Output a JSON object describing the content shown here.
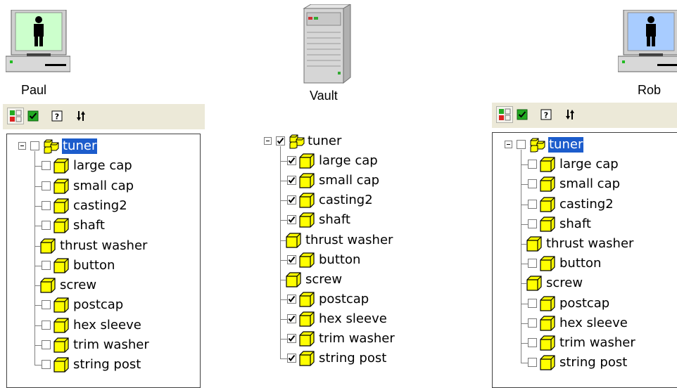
{
  "users": {
    "paul": "Paul",
    "vault": "Vault",
    "rob": "Rob"
  },
  "tree": {
    "root": "tuner",
    "items": [
      "large cap",
      "small cap",
      "casting2",
      "shaft",
      "thrust washer",
      "button",
      "screw",
      "postcap",
      "hex sleeve",
      "trim washer",
      "string post"
    ]
  },
  "colors": {
    "screen_paul": "#ccffcc",
    "screen_rob": "#a8ccff",
    "folder": "#ffff00",
    "selection": "#1c5ccc",
    "toolbar": "#ece9d8"
  },
  "icons": [
    "person-computer-icon",
    "server-icon",
    "tree-view-icon",
    "check-icon",
    "help-icon",
    "refresh-icon",
    "assembly-icon",
    "part-icon"
  ]
}
